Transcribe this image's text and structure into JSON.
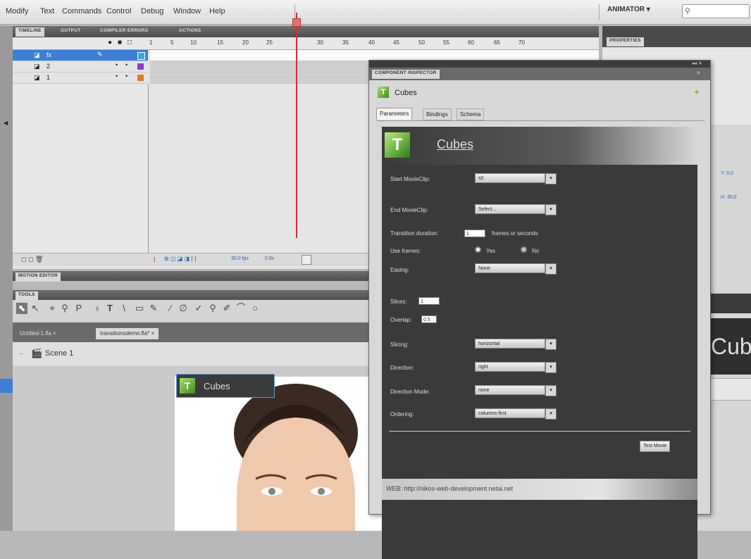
{
  "menu": {
    "items": [
      "Modify",
      "Text",
      "Commands",
      "Control",
      "Debug",
      "Window",
      "Help"
    ],
    "workspace": "ANIMATOR ▾"
  },
  "timeline": {
    "tabs": [
      "TIMELINE",
      "OUTPUT",
      "COMPILER ERRORS",
      "ACTIONS"
    ],
    "ruler": [
      "1",
      "5",
      "10",
      "15",
      "20",
      "25",
      "30",
      "35",
      "40",
      "45",
      "50",
      "55",
      "60",
      "65",
      "70"
    ],
    "layers": [
      {
        "name": "fx",
        "color": "#3aa7e0"
      },
      {
        "name": "2",
        "color": "#8a3cc9"
      },
      {
        "name": "1",
        "color": "#e07a20"
      }
    ],
    "fps": "30.0 fps",
    "time": "0.8s"
  },
  "motion_editor": {
    "title": "MOTION EDITOR"
  },
  "tools": {
    "title": "TOOLS",
    "glyphs": [
      "⬉",
      "↖",
      "⌖",
      "⚲",
      "P",
      "♁",
      "T",
      "\\",
      "▭",
      "✎",
      "⁄",
      "∅",
      "✓",
      "⚲",
      "✐",
      "⌒",
      "○"
    ]
  },
  "docs": {
    "tabs": [
      "Untitled-1.fla",
      "transitionsdemo.fla*"
    ],
    "scene": "Scene 1"
  },
  "stage_component": {
    "label": "Cubes"
  },
  "properties": {
    "title": "PROPERTIES",
    "labels": [
      "Y: 0.0",
      "H: 30.0"
    ],
    "cubes_fragment": "Cub"
  },
  "inspector": {
    "title": "COMPONENT INSPECTOR",
    "component_name": "Cubes",
    "tabs": [
      "Parameters",
      "Bindings",
      "Schema"
    ],
    "banner_title": "Cubes",
    "params": {
      "start_movieclip": {
        "label": "Start MovieClip:",
        "value": "s0"
      },
      "end_movieclip": {
        "label": "End MovieClip:",
        "value": "Select..."
      },
      "transition_duration": {
        "label": "Transition duration:",
        "value": "1",
        "suffix": "frames or seconds"
      },
      "use_frames": {
        "label": "Use frames:",
        "yes": "Yes",
        "no": "No"
      },
      "easing": {
        "label": "Easing:",
        "value": "None"
      },
      "slices": {
        "label": "Slices:",
        "value": "1"
      },
      "overlap": {
        "label": "Overlap:",
        "value": "0.5"
      },
      "slicing": {
        "label": "Slicing:",
        "value": "horizontal"
      },
      "direction": {
        "label": "Direction:",
        "value": "right"
      },
      "direction_mode": {
        "label": "Direction Mode:",
        "value": "none"
      },
      "ordering": {
        "label": "Ordering:",
        "value": "columns-first"
      }
    },
    "test_button": "Test Movie",
    "web_url": "WEB: http://nikos-web-development.netai.net"
  },
  "colors": {
    "accent": "#76c043",
    "selected": "#3d7fd6",
    "playhead": "#dd2a2a"
  }
}
